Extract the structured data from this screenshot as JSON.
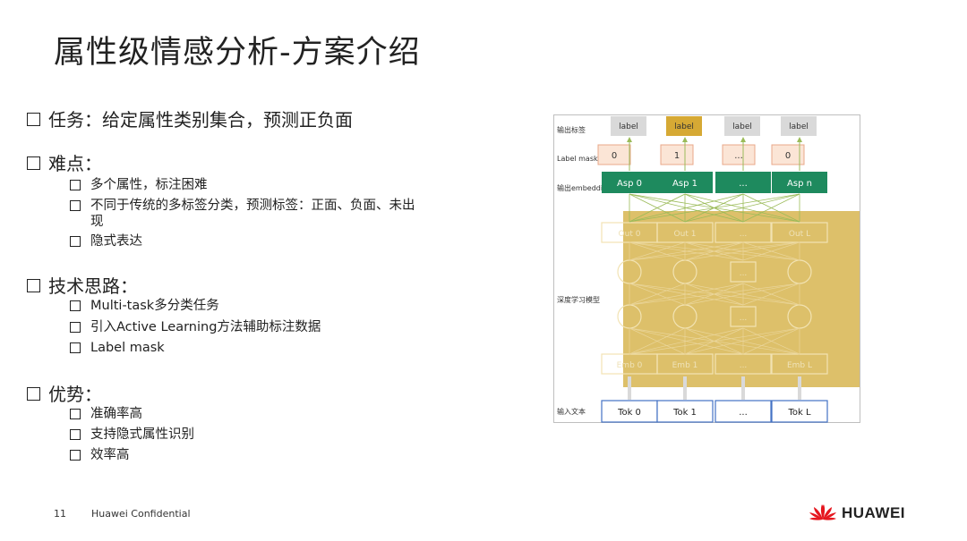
{
  "slide": {
    "title": "属性级情感分析-方案介绍",
    "page_number": "11",
    "confidential": "Huawei Confidential",
    "brand": "HUAWEI",
    "brand_color": "#e5171f"
  },
  "bullets": {
    "task": "任务：给定属性类别集合，预测正负面",
    "difficulty": {
      "heading": "难点：",
      "items": [
        "多个属性，标注困难",
        "不同于传统的多标签分类，预测标签：正面、负面、未出现",
        "隐式表达"
      ]
    },
    "approach": {
      "heading": "技术思路：",
      "items": [
        "Multi-task多分类任务",
        "引入Active Learning方法辅助标注数据",
        "Label mask"
      ]
    },
    "advantage": {
      "heading": "优势：",
      "items": [
        "准确率高",
        "支持隐式属性识别",
        "效率高"
      ]
    }
  },
  "diagram": {
    "row_labels": {
      "output_label": "输出标签",
      "label_mask": "Label mask",
      "output_embedding": "输出embedding",
      "deep_model": "深度学习模型",
      "input_text": "输入文本"
    },
    "labels": [
      "label",
      "label",
      "label",
      "label"
    ],
    "masks": [
      "0",
      "1",
      "...",
      "0"
    ],
    "aspects": [
      "Asp 0",
      "Asp 1",
      "...",
      "Asp n"
    ],
    "outs": [
      "Out 0",
      "Out 1",
      "...",
      "Out L"
    ],
    "middle": [
      "..."
    ],
    "middle2": [
      "..."
    ],
    "embs": [
      "Emb 0",
      "Emb 1",
      "...",
      "Emb L"
    ],
    "toks": [
      "Tok 0",
      "Tok 1",
      "...",
      "Tok L"
    ],
    "colors": {
      "label_grey": "#d9d9d9",
      "label_highlight": "#d6a934",
      "mask_fill": "#fbe5d6",
      "mask_border": "#e8a88a",
      "aspect_green": "#1e8a5e",
      "model_gold": "#d9b95a",
      "tok_border": "#4472c4",
      "arrow_green": "#9bbb59"
    }
  }
}
